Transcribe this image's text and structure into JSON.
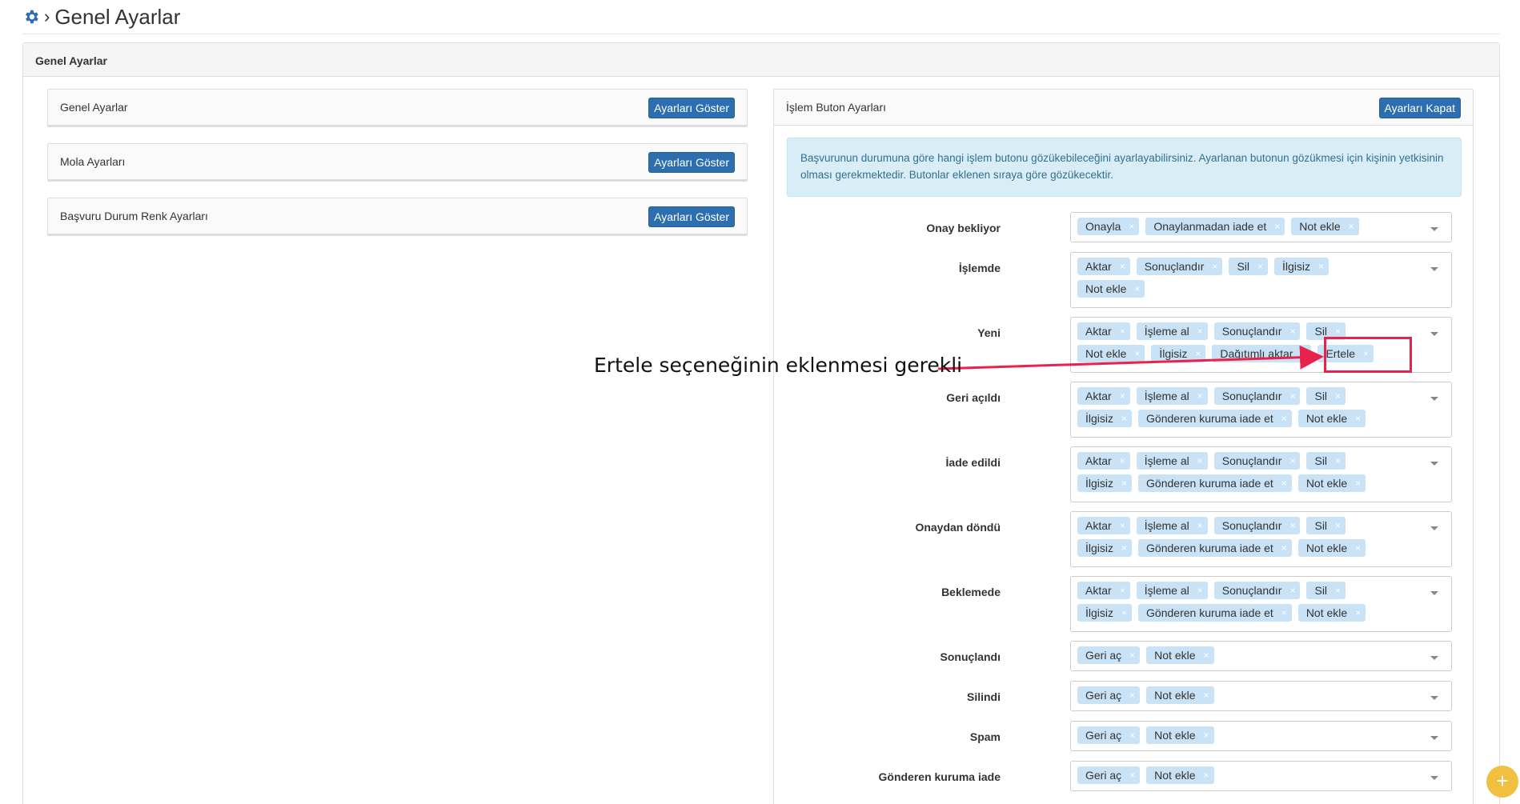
{
  "header": {
    "title": "Genel Ayarlar"
  },
  "outer_panel": {
    "title": "Genel Ayarlar"
  },
  "left_panels": [
    {
      "label": "Genel Ayarlar",
      "button": "Ayarları Göster"
    },
    {
      "label": "Mola Ayarları",
      "button": "Ayarları Göster"
    },
    {
      "label": "Başvuru Durum Renk Ayarları",
      "button": "Ayarları Göster"
    }
  ],
  "right_panel": {
    "title": "İşlem Buton Ayarları",
    "button": "Ayarları Kapat",
    "info": "Başvurunun durumuna göre hangi işlem butonu gözükebileceğini ayarlayabilirsiniz. Ayarlanan butonun gözükmesi için kişinin yetkisinin olması gerekmektedir. Butonlar eklenen sıraya göre gözükecektir.",
    "rows": [
      {
        "label": "Onay bekliyor",
        "tags": [
          "Onayla",
          "Onaylanmadan iade et",
          "Not ekle"
        ]
      },
      {
        "label": "İşlemde",
        "tags": [
          "Aktar",
          "Sonuçlandır",
          "Sil",
          "İlgisiz",
          "Not ekle"
        ]
      },
      {
        "label": "Yeni",
        "tags": [
          "Aktar",
          "İşleme al",
          "Sonuçlandır",
          "Sil",
          "Not ekle",
          "İlgisiz",
          "Dağıtımlı aktar",
          "Ertele"
        ]
      },
      {
        "label": "Geri açıldı",
        "tags": [
          "Aktar",
          "İşleme al",
          "Sonuçlandır",
          "Sil",
          "İlgisiz",
          "Gönderen kuruma iade et",
          "Not ekle"
        ]
      },
      {
        "label": "İade edildi",
        "tags": [
          "Aktar",
          "İşleme al",
          "Sonuçlandır",
          "Sil",
          "İlgisiz",
          "Gönderen kuruma iade et",
          "Not ekle"
        ]
      },
      {
        "label": "Onaydan döndü",
        "tags": [
          "Aktar",
          "İşleme al",
          "Sonuçlandır",
          "Sil",
          "İlgisiz",
          "Gönderen kuruma iade et",
          "Not ekle"
        ]
      },
      {
        "label": "Beklemede",
        "tags": [
          "Aktar",
          "İşleme al",
          "Sonuçlandır",
          "Sil",
          "İlgisiz",
          "Gönderen kuruma iade et",
          "Not ekle"
        ]
      },
      {
        "label": "Sonuçlandı",
        "tags": [
          "Geri aç",
          "Not ekle"
        ]
      },
      {
        "label": "Silindi",
        "tags": [
          "Geri aç",
          "Not ekle"
        ]
      },
      {
        "label": "Spam",
        "tags": [
          "Geri aç",
          "Not ekle"
        ]
      },
      {
        "label": "Gönderen kuruma iade",
        "tags": [
          "Geri aç",
          "Not ekle"
        ]
      }
    ]
  },
  "annotation": {
    "text": "Ertele seçeneğinin eklenmesi gerekli",
    "color": "#e8224a"
  },
  "icons": {
    "header": "gear-icon",
    "remove": "close-icon",
    "dropdown": "caret-down-icon",
    "fab": "plus-icon"
  },
  "fab": {
    "symbol": "+"
  }
}
